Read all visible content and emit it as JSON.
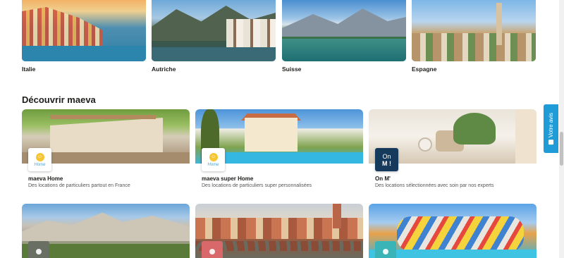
{
  "destinations": [
    {
      "label": "Italie"
    },
    {
      "label": "Autriche"
    },
    {
      "label": "Suisse"
    },
    {
      "label": "Espagne"
    }
  ],
  "discover": {
    "title": "Découvrir maeva",
    "offers": [
      {
        "title": "maeva Home",
        "desc": "Des locations de particuliers partout en France",
        "logo_text": "Home"
      },
      {
        "title": "maeva super Home",
        "desc": "Des locations de particuliers super personnalisées",
        "logo_text": "Home"
      },
      {
        "title": "On M'",
        "desc": "Des locations sélectionnées avec soin par nos experts",
        "logo_line1": "On",
        "logo_line2": "M !"
      }
    ]
  },
  "side_tab": {
    "label": "Votre avis"
  },
  "colors": {
    "accent": "#1f9bd7",
    "onm_logo": "#163a5c",
    "home_logo_sun": "#f6c632"
  },
  "icons": {
    "side_tab_icon": "feedback-icon"
  }
}
